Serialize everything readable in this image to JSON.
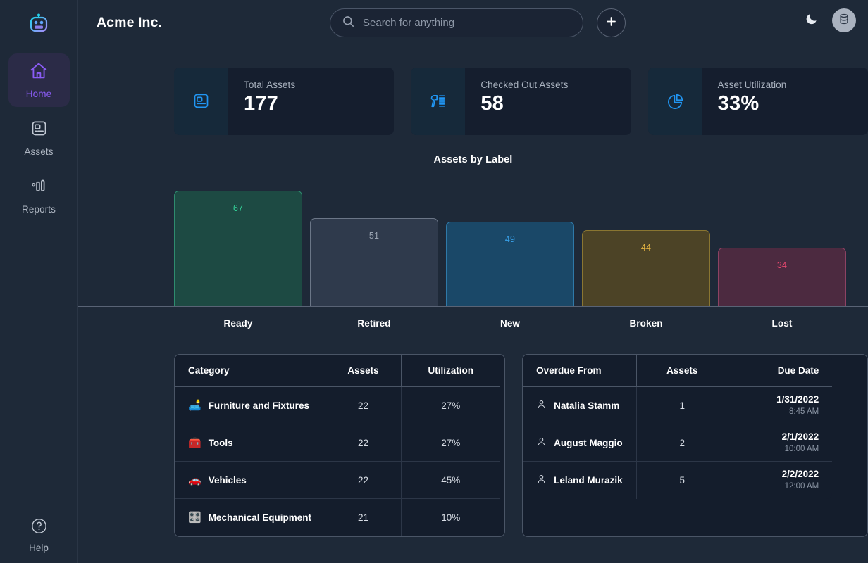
{
  "sidebar": {
    "logo_icon": "robot-logo-icon",
    "items": [
      {
        "label": "Home",
        "icon": "home-icon",
        "active": true
      },
      {
        "label": "Assets",
        "icon": "assets-icon",
        "active": false
      },
      {
        "label": "Reports",
        "icon": "reports-icon",
        "active": false
      }
    ],
    "help": {
      "label": "Help",
      "icon": "help-circle-icon"
    }
  },
  "header": {
    "brand": "Acme Inc.",
    "search": {
      "value": "",
      "placeholder": "Search for anything",
      "icon": "search-icon"
    },
    "add_button": {
      "label": "+",
      "icon": "plus-icon"
    },
    "theme_toggle": {
      "icon": "moon-icon"
    },
    "avatar": {
      "icon": "database-icon"
    }
  },
  "stats": [
    {
      "title": "Total Assets",
      "value": "177",
      "icon": "asset-box-icon"
    },
    {
      "title": "Checked Out Assets",
      "value": "58",
      "icon": "barcode-scanner-icon"
    },
    {
      "title": "Asset Utilization",
      "value": "33%",
      "icon": "pie-chart-icon"
    }
  ],
  "chart_data": {
    "type": "bar",
    "title": "Assets by Label",
    "xlabel": "",
    "ylabel": "",
    "categories": [
      "Ready",
      "Retired",
      "New",
      "Broken",
      "Lost"
    ],
    "values": [
      67,
      51,
      49,
      44,
      34
    ],
    "ylim": [
      0,
      74
    ],
    "grid": false,
    "legend": "none",
    "colors": {
      "Ready": {
        "fill": "#1d4a43",
        "border": "#2e8c6f",
        "label": "#34d399"
      },
      "Retired": {
        "fill": "#2f3a4c",
        "border": "#6b7687",
        "label": "#9aa4b2"
      },
      "New": {
        "fill": "#1a4868",
        "border": "#2f79a8",
        "label": "#38a0e8"
      },
      "Broken": {
        "fill": "#4c4326",
        "border": "#8a7631",
        "label": "#e3b341"
      },
      "Lost": {
        "fill": "#4c2a40",
        "border": "#8d4263",
        "label": "#e8486f"
      }
    }
  },
  "category_table": {
    "columns": [
      "Category",
      "Assets",
      "Utilization"
    ],
    "rows": [
      {
        "emoji": "🛋️",
        "name": "Furniture and Fixtures",
        "assets": "22",
        "utilization": "27%"
      },
      {
        "emoji": "🧰",
        "name": "Tools",
        "assets": "22",
        "utilization": "27%"
      },
      {
        "emoji": "🚗",
        "name": "Vehicles",
        "assets": "22",
        "utilization": "45%"
      },
      {
        "emoji": "🎛️",
        "name": "Mechanical Equipment",
        "assets": "21",
        "utilization": "10%"
      }
    ]
  },
  "overdue_table": {
    "columns": [
      "Overdue From",
      "Assets",
      "Due Date"
    ],
    "rows": [
      {
        "name": "Natalia Stamm",
        "assets": "1",
        "date": "1/31/2022",
        "time": "8:45 AM"
      },
      {
        "name": "August Maggio",
        "assets": "2",
        "date": "2/1/2022",
        "time": "10:00 AM"
      },
      {
        "name": "Leland Murazik",
        "assets": "5",
        "date": "2/2/2022",
        "time": "12:00 AM"
      }
    ]
  }
}
